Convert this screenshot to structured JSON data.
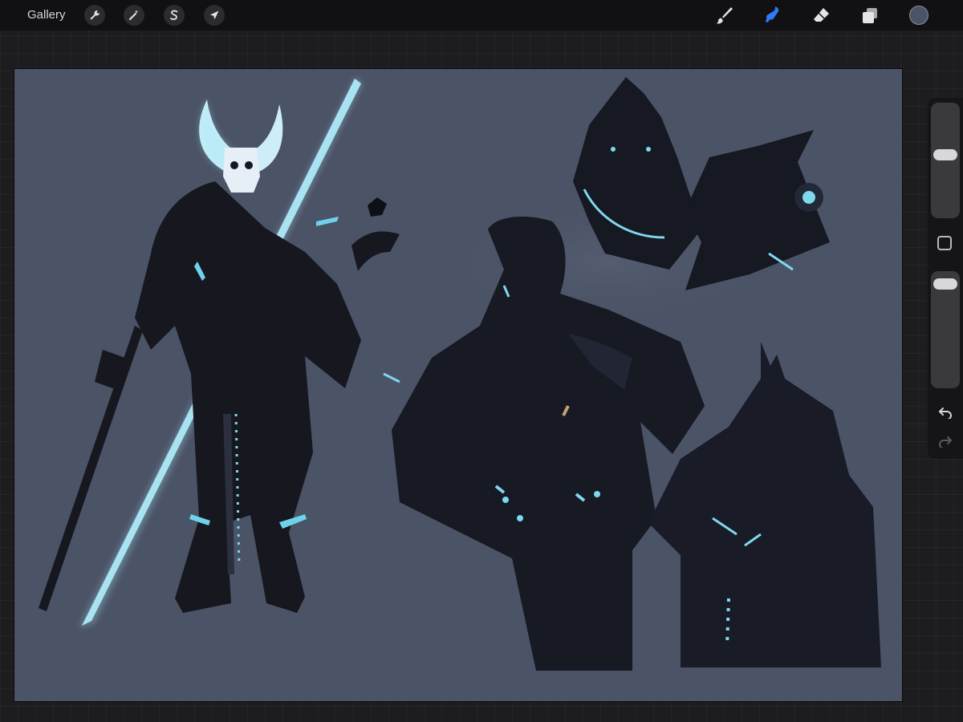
{
  "app": {
    "gallery_label": "Gallery"
  },
  "toolbar": {
    "left_tools": [
      {
        "name": "actions",
        "icon": "wrench-icon"
      },
      {
        "name": "adjustments",
        "icon": "magic-wand-icon"
      },
      {
        "name": "selection",
        "icon": "selection-s-icon"
      },
      {
        "name": "transform",
        "icon": "transform-arrow-icon"
      }
    ],
    "right_tools": [
      {
        "name": "brush",
        "icon": "brush-icon",
        "active": false
      },
      {
        "name": "smudge",
        "icon": "smudge-icon",
        "active": true
      },
      {
        "name": "eraser",
        "icon": "eraser-icon",
        "active": false
      },
      {
        "name": "layers",
        "icon": "layers-icon",
        "active": false
      }
    ],
    "current_color": "#4a5368",
    "active_color": "#2f7bf5"
  },
  "sidebar": {
    "brush_size": 0.55,
    "brush_opacity": 0.93,
    "undo_icon": "undo-icon",
    "redo_icon": "redo-icon",
    "modify_icon": "square-icon"
  },
  "canvas": {
    "background": "#4b5366",
    "figure_color": "#15161f",
    "glow_color": "#8fe6f2"
  }
}
